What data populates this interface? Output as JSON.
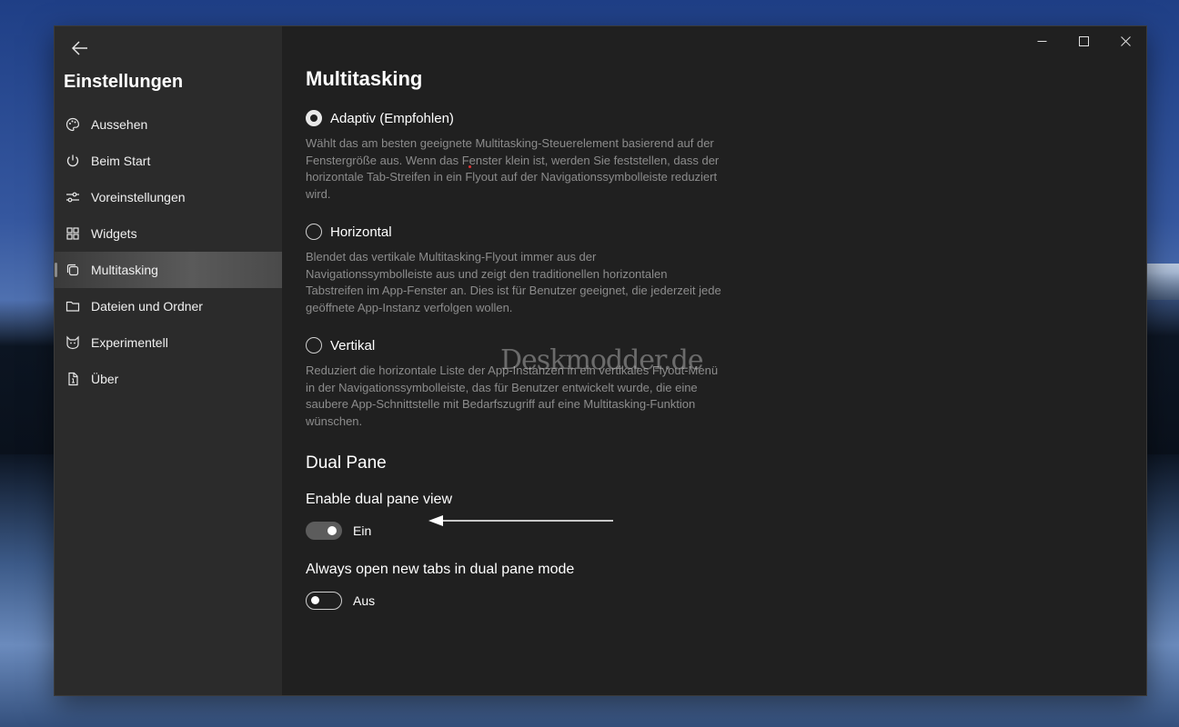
{
  "sidebar": {
    "title": "Einstellungen",
    "items": [
      {
        "label": "Aussehen",
        "icon": "palette-icon"
      },
      {
        "label": "Beim Start",
        "icon": "power-icon"
      },
      {
        "label": "Voreinstellungen",
        "icon": "sliders-icon"
      },
      {
        "label": "Widgets",
        "icon": "widgets-icon"
      },
      {
        "label": "Multitasking",
        "icon": "multitasking-icon",
        "active": true
      },
      {
        "label": "Dateien und Ordner",
        "icon": "folder-icon"
      },
      {
        "label": "Experimentell",
        "icon": "cat-icon"
      },
      {
        "label": "Über",
        "icon": "info-icon"
      }
    ]
  },
  "content": {
    "title": "Multitasking",
    "options": [
      {
        "label": "Adaptiv (Empfohlen)",
        "checked": true,
        "description": "Wählt das am besten geeignete Multitasking-Steuerelement basierend auf der Fenstergröße aus. Wenn das Fenster klein ist, werden Sie feststellen, dass der horizontale Tab-Streifen in ein Flyout auf der Navigationssymbolleiste reduziert wird."
      },
      {
        "label": "Horizontal",
        "checked": false,
        "description": "Blendet das vertikale Multitasking-Flyout immer aus der Navigationssymbolleiste aus und zeigt den traditionellen horizontalen Tabstreifen im App-Fenster an. Dies ist für Benutzer geeignet, die jederzeit jede geöffnete App-Instanz verfolgen wollen."
      },
      {
        "label": "Vertikal",
        "checked": false,
        "description": "Reduziert die horizontale Liste der App-Instanzen in ein vertikales Flyout-Menü in der Navigationssymbolleiste, das für Benutzer entwickelt wurde, die eine saubere App-Schnittstelle mit Bedarfszugriff auf eine Multitasking-Funktion wünschen."
      }
    ],
    "dual_pane": {
      "section_title": "Dual Pane",
      "enable_label": "Enable dual pane view",
      "enable_state": "Ein",
      "always_label": "Always open new tabs in dual pane mode",
      "always_state": "Aus"
    }
  },
  "watermark": "Deskmodder.de",
  "colors": {
    "window_bg": "#202020",
    "sidebar_bg": "#2b2b2b",
    "desc_text": "#8c8c8c"
  }
}
